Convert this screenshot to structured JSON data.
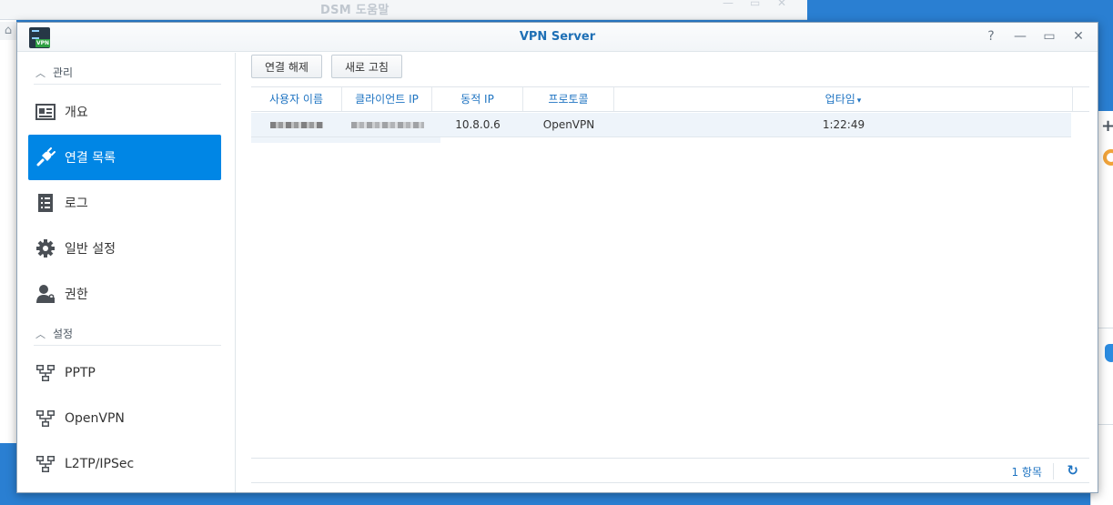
{
  "background": {
    "window_title": "DSM 도움말"
  },
  "window": {
    "title": "VPN Server",
    "controls": {
      "help": "?",
      "minimize": "—",
      "maximize": "▭",
      "close": "✕"
    },
    "app_icon_badge": "VPN"
  },
  "sidebar": {
    "section_manage": "관리",
    "section_settings": "설정",
    "items": [
      {
        "label": "개요",
        "icon": "overview-card-icon"
      },
      {
        "label": "연결 목록",
        "icon": "plug-icon",
        "active": true
      },
      {
        "label": "로그",
        "icon": "log-list-icon"
      },
      {
        "label": "일반 설정",
        "icon": "gear-icon"
      },
      {
        "label": "권한",
        "icon": "user-lock-icon"
      }
    ],
    "protocol_items": [
      {
        "label": "PPTP",
        "icon": "network-icon"
      },
      {
        "label": "OpenVPN",
        "icon": "network-icon"
      },
      {
        "label": "L2TP/IPSec",
        "icon": "network-icon"
      }
    ]
  },
  "toolbar": {
    "disconnect_label": "연결 해제",
    "refresh_label": "새로 고침"
  },
  "table": {
    "columns": [
      "사용자 이름",
      "클라이언트 IP",
      "동적 IP",
      "프로토콜",
      "업타임"
    ],
    "sort_indicator": "▾",
    "rows": [
      {
        "user": "",
        "client_ip": "",
        "dynamic_ip": "10.8.0.6",
        "protocol": "OpenVPN",
        "uptime": "1:22:49"
      }
    ]
  },
  "footer": {
    "count": "1 항목"
  },
  "colors": {
    "accent": "#0086e5",
    "link_blue": "#1f74c2",
    "desktop": "#2a7fd2"
  }
}
